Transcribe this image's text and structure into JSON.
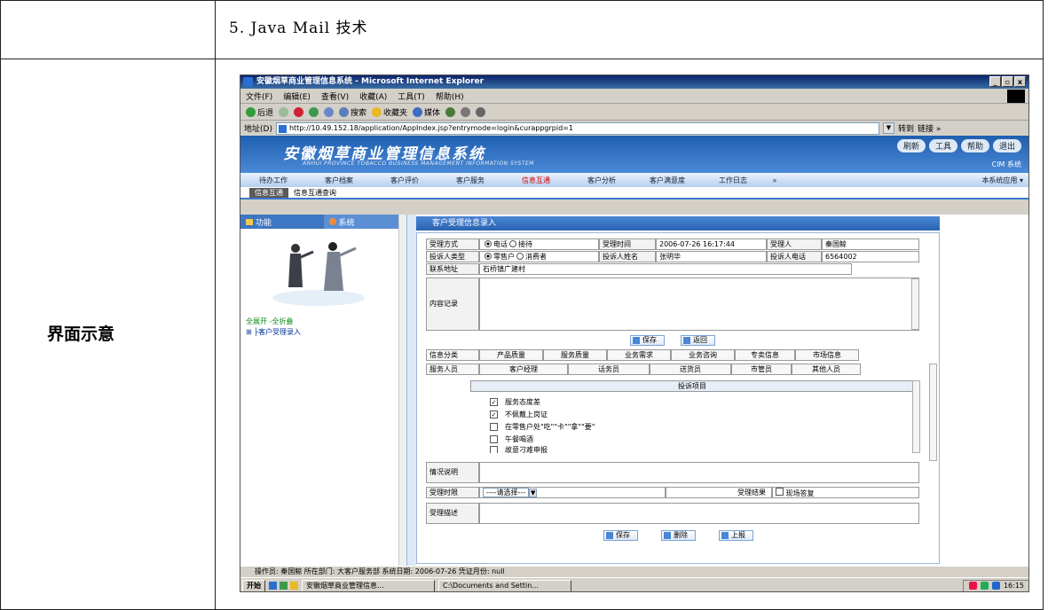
{
  "document": {
    "title": "5.  Java Mail 技术",
    "label": "界面示意"
  },
  "window": {
    "title": "安徽烟草商业管理信息系统 - Microsoft Internet Explorer",
    "min_btn": "_",
    "max_btn": "▫",
    "close_btn": "x",
    "menus": [
      "文件(F)",
      "编辑(E)",
      "查看(V)",
      "收藏(A)",
      "工具(T)",
      "帮助(H)"
    ],
    "toolbar": {
      "back": "后退",
      "search": "搜索",
      "favorites": "收藏夹",
      "media": "媒体"
    },
    "address_label": "地址(D)",
    "address_url": "http://10.49.152.18/application/AppIndex.jsp?entrymode=login&curappgrpid=1",
    "go_label": "转到",
    "links_label": "链接 »"
  },
  "app": {
    "title": "安徽烟草商业管理信息系统",
    "subtitle": "ANHUI PROVINCE TOBACCO BUSINESS MANAGEMENT INFORMATION SYSTEM",
    "header_buttons": [
      "刷新",
      "工具",
      "帮助",
      "退出"
    ],
    "system_label": "CIM 系统",
    "nav": [
      "待办工作",
      "客户档案",
      "客户评价",
      "客户服务",
      "信息互通",
      "客户分析",
      "客户满意度",
      "工作日志",
      "»"
    ],
    "nav_active": "信息互通",
    "nav_right": "本系统应用 ▾",
    "subnav": [
      "信息互通",
      "信息互通查询"
    ]
  },
  "left_pane": {
    "tab_function": "功能",
    "tab_system": "系统",
    "expand_links": "全展开 -全折叠",
    "tree_item": "客户受理录入"
  },
  "form": {
    "title": "客户受理信息录入",
    "r1": {
      "l1": "受理方式",
      "opt1": "电话",
      "opt2": "接待",
      "l2": "受理时间",
      "v2": "2006-07-26 16:17:44",
      "l3": "受理人",
      "v3": "秦国鲸"
    },
    "r2": {
      "l1": "投诉人类型",
      "opt1": "零售户",
      "opt2": "消费者",
      "l2": "投诉人姓名",
      "v2": "张明华",
      "l3": "投诉人电话",
      "v3": "6564002"
    },
    "r3": {
      "l1": "联系地址",
      "v1": "石桥镇广建村"
    },
    "content_label": "内容记录",
    "save": "保存",
    "back": "返回",
    "category_label": "信息分类",
    "categories": [
      "产品质量",
      "服务质量",
      "业务需求",
      "业务咨询",
      "专卖信息",
      "市场信息"
    ],
    "staff_label": "服务人员",
    "staff": [
      "客户经理",
      "话务员",
      "送货员",
      "市管员",
      "其他人员"
    ],
    "complaint_header": "投诉项目",
    "complaints": [
      "服务态度差",
      "不佩戴上岗证",
      "在零售户处\"吃\"\"卡\"\"拿\"\"要\"",
      "午餐喝酒",
      "故意刁难申报"
    ],
    "complaints_checked": [
      true,
      true,
      false,
      false,
      false
    ],
    "situation_label": "情况说明",
    "deadline_label": "受理时限",
    "deadline_value": "----请选择---",
    "result_label": "受理结果",
    "onsite_label": "现场答复",
    "desc_label": "受理描述",
    "btn_save": "保存",
    "btn_delete": "删除",
    "btn_report": "上报"
  },
  "status": "操作员: 秦国鲸    所在部门: 大客户服务部    系统日期: 2006-07-26    凭证月份: null",
  "taskbar": {
    "start": "开始",
    "task1": "安徽烟草商业管理信息...",
    "task2": "C:\\Documents and Settin...",
    "clock": "16:15"
  }
}
